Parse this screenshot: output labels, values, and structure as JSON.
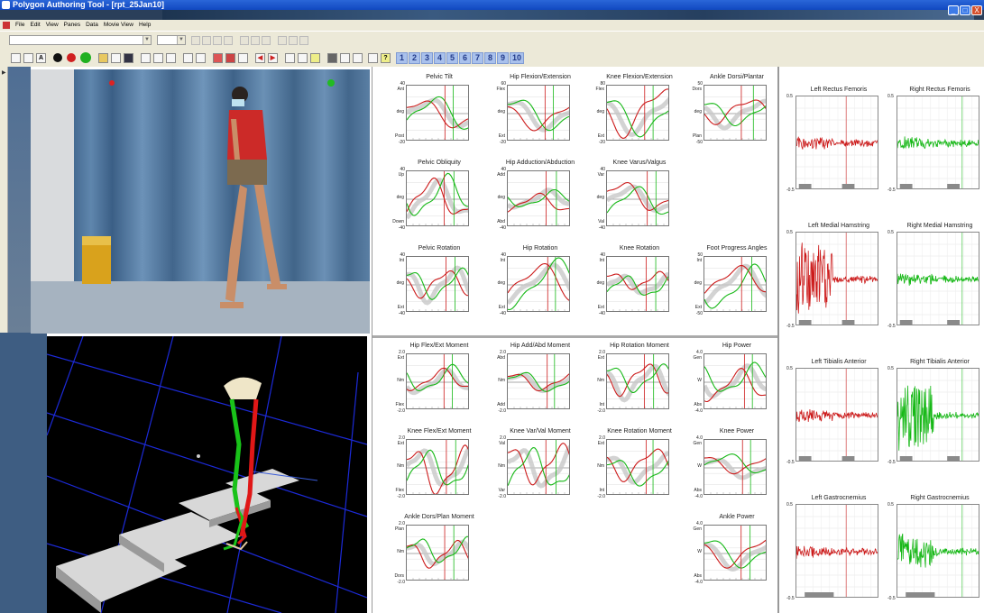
{
  "window": {
    "title": "Polygon Authoring Tool - [rpt_25Jan10]",
    "buttons": [
      "_",
      "□",
      "X"
    ]
  },
  "menu": {
    "items": [
      "File",
      "Edit",
      "View",
      "Panes",
      "Data",
      "Movie View",
      "Help"
    ]
  },
  "toolbar2": {
    "letter_button": "A",
    "number_buttons": [
      "1",
      "2",
      "3",
      "4",
      "5",
      "6",
      "7",
      "8",
      "9",
      "10"
    ]
  },
  "colors": {
    "left": "#cc1a1a",
    "right": "#16b816",
    "normal": "#c8c8c8",
    "titlebar": "#1a57d0",
    "toolbar": "#ece9d8"
  },
  "kinematics": [
    {
      "title": "Pelvic Tilt",
      "top": "40",
      "labels": [
        "Ant",
        "deg",
        "Post"
      ],
      "bottom": "-20"
    },
    {
      "title": "Hip Flexion/Extension",
      "top": "60",
      "labels": [
        "Flex",
        "deg",
        "Ext"
      ],
      "bottom": "-20"
    },
    {
      "title": "Knee Flexion/Extension",
      "top": "80",
      "labels": [
        "Flex",
        "deg",
        "Ext"
      ],
      "bottom": "-20"
    },
    {
      "title": "Ankle Dorsi/Plantar",
      "top": "50",
      "labels": [
        "Dors",
        "deg",
        "Plan"
      ],
      "bottom": "-50"
    },
    {
      "title": "Pelvic Obliquity",
      "top": "40",
      "labels": [
        "Up",
        "deg",
        "Down"
      ],
      "bottom": "-40"
    },
    {
      "title": "Hip Adduction/Abduction",
      "top": "40",
      "labels": [
        "Add",
        "deg",
        "Abd"
      ],
      "bottom": "-40"
    },
    {
      "title": "Knee Varus/Valgus",
      "top": "40",
      "labels": [
        "Var",
        "deg",
        "Val"
      ],
      "bottom": "-40"
    },
    {
      "title": "",
      "top": "",
      "labels": [
        "",
        "",
        ""
      ],
      "bottom": ""
    },
    {
      "title": "Pelvic Rotation",
      "top": "40",
      "labels": [
        "Int",
        "deg",
        "Ext"
      ],
      "bottom": "-40"
    },
    {
      "title": "Hip Rotation",
      "top": "40",
      "labels": [
        "Int",
        "deg",
        "Ext"
      ],
      "bottom": "-40"
    },
    {
      "title": "Knee Rotation",
      "top": "40",
      "labels": [
        "Int",
        "deg",
        "Ext"
      ],
      "bottom": "-40"
    },
    {
      "title": "Foot Progress Angles",
      "top": "50",
      "labels": [
        "Int",
        "deg",
        "Ext"
      ],
      "bottom": "-50"
    }
  ],
  "kinetics": [
    {
      "title": "Hip Flex/Ext Moment",
      "top": "2.0",
      "labels": [
        "Ext",
        "Nm",
        "Flex"
      ],
      "bottom": "-2.0"
    },
    {
      "title": "Hip Add/Abd Moment",
      "top": "2.0",
      "labels": [
        "Abd",
        "Nm",
        "Add"
      ],
      "bottom": "-2.0"
    },
    {
      "title": "Hip Rotation Moment",
      "top": "2.0",
      "labels": [
        "Ext",
        "Nm",
        "Int"
      ],
      "bottom": "-2.0"
    },
    {
      "title": "Hip Power",
      "top": "4.0",
      "labels": [
        "Gen",
        "W",
        "Abs"
      ],
      "bottom": "-4.0"
    },
    {
      "title": "Knee Flex/Ext Moment",
      "top": "2.0",
      "labels": [
        "Ext",
        "Nm",
        "Flex"
      ],
      "bottom": "-2.0"
    },
    {
      "title": "Knee Var/Val Moment",
      "top": "2.0",
      "labels": [
        "Val",
        "Nm",
        "Var"
      ],
      "bottom": "-2.0"
    },
    {
      "title": "Knee Rotation Moment",
      "top": "2.0",
      "labels": [
        "Ext",
        "Nm",
        "Int"
      ],
      "bottom": "-2.0"
    },
    {
      "title": "Knee Power",
      "top": "4.0",
      "labels": [
        "Gen",
        "W",
        "Abs"
      ],
      "bottom": "-4.0"
    },
    {
      "title": "Ankle Dors/Plan Moment",
      "top": "2.0",
      "labels": [
        "Plan",
        "Nm",
        "Dors"
      ],
      "bottom": "-2.0"
    },
    {
      "title": "",
      "top": "",
      "labels": [
        "",
        "",
        ""
      ],
      "bottom": ""
    },
    {
      "title": "",
      "top": "",
      "labels": [
        "",
        "",
        ""
      ],
      "bottom": ""
    },
    {
      "title": "Ankle Power",
      "top": "4.0",
      "labels": [
        "Gen",
        "W",
        "Abs"
      ],
      "bottom": "-4.0"
    }
  ],
  "emg": [
    {
      "title": "Left Rectus Femoris",
      "top": "0.5",
      "bottom": "-0.5"
    },
    {
      "title": "Right Rectus Femoris",
      "top": "0.5",
      "bottom": "-0.5"
    },
    {
      "title": "Left Medial Hamstring",
      "top": "0.5",
      "bottom": "-0.5"
    },
    {
      "title": "Right Medial Hamstring",
      "top": "0.5",
      "bottom": "-0.5"
    },
    {
      "title": "Left Tibialis Anterior",
      "top": "0.5",
      "bottom": "-0.5"
    },
    {
      "title": "Right Tibialis Anterior",
      "top": "0.5",
      "bottom": "-0.5"
    },
    {
      "title": "Left Gastrocnemius",
      "top": "0.5",
      "bottom": "-0.5"
    },
    {
      "title": "Right Gastrocnemius",
      "top": "0.5",
      "bottom": "-0.5"
    }
  ]
}
